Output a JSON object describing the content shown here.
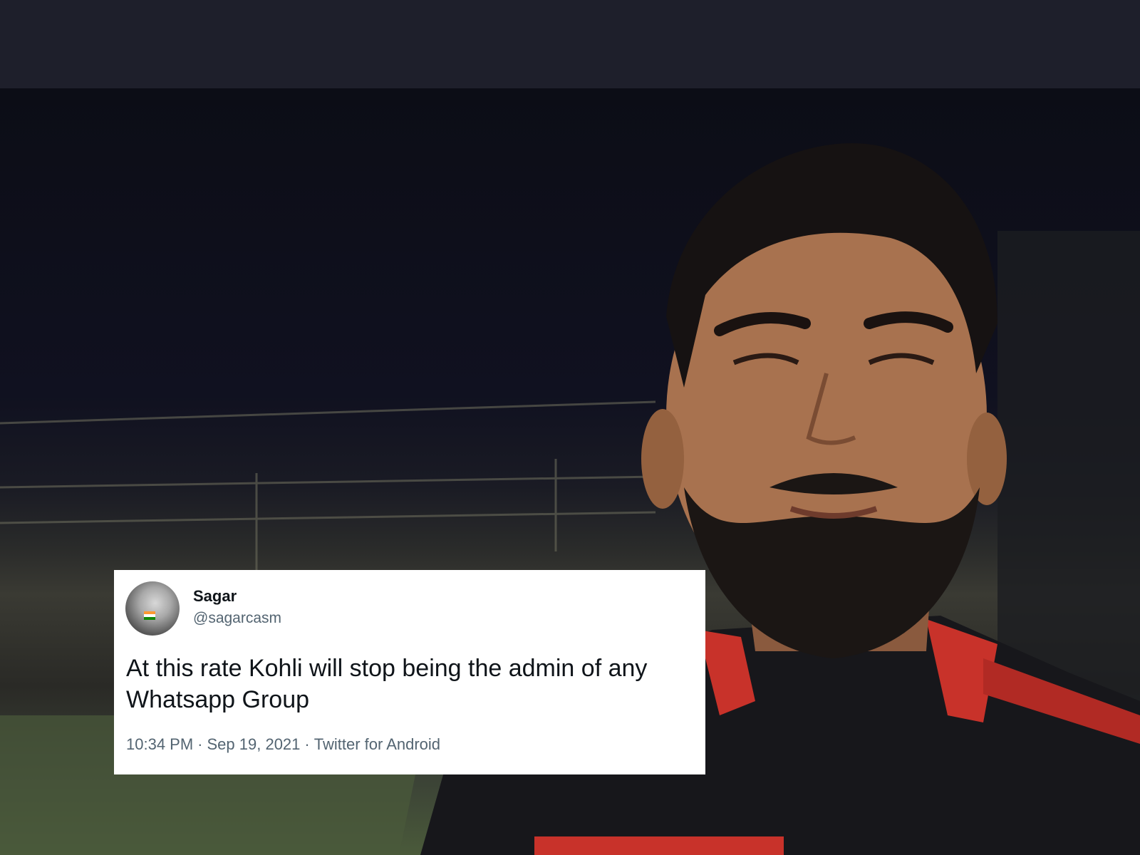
{
  "tweet": {
    "author_name": "Sagar",
    "author_handle": "@sagarcasm",
    "text": "At this rate Kohli will stop being the admin of any Whatsapp Group",
    "time": "10:34 PM",
    "date": "Sep 19, 2021",
    "source": "Twitter for Android",
    "separator": "·"
  },
  "colors": {
    "card_bg": "#ffffff",
    "text_primary": "#0f1419",
    "text_secondary": "#536471",
    "jersey_red": "#c8322a",
    "background_dark": "#1e1f2b"
  },
  "icons": {
    "avatar": "profile-photo",
    "flag": "india-flag-icon"
  }
}
